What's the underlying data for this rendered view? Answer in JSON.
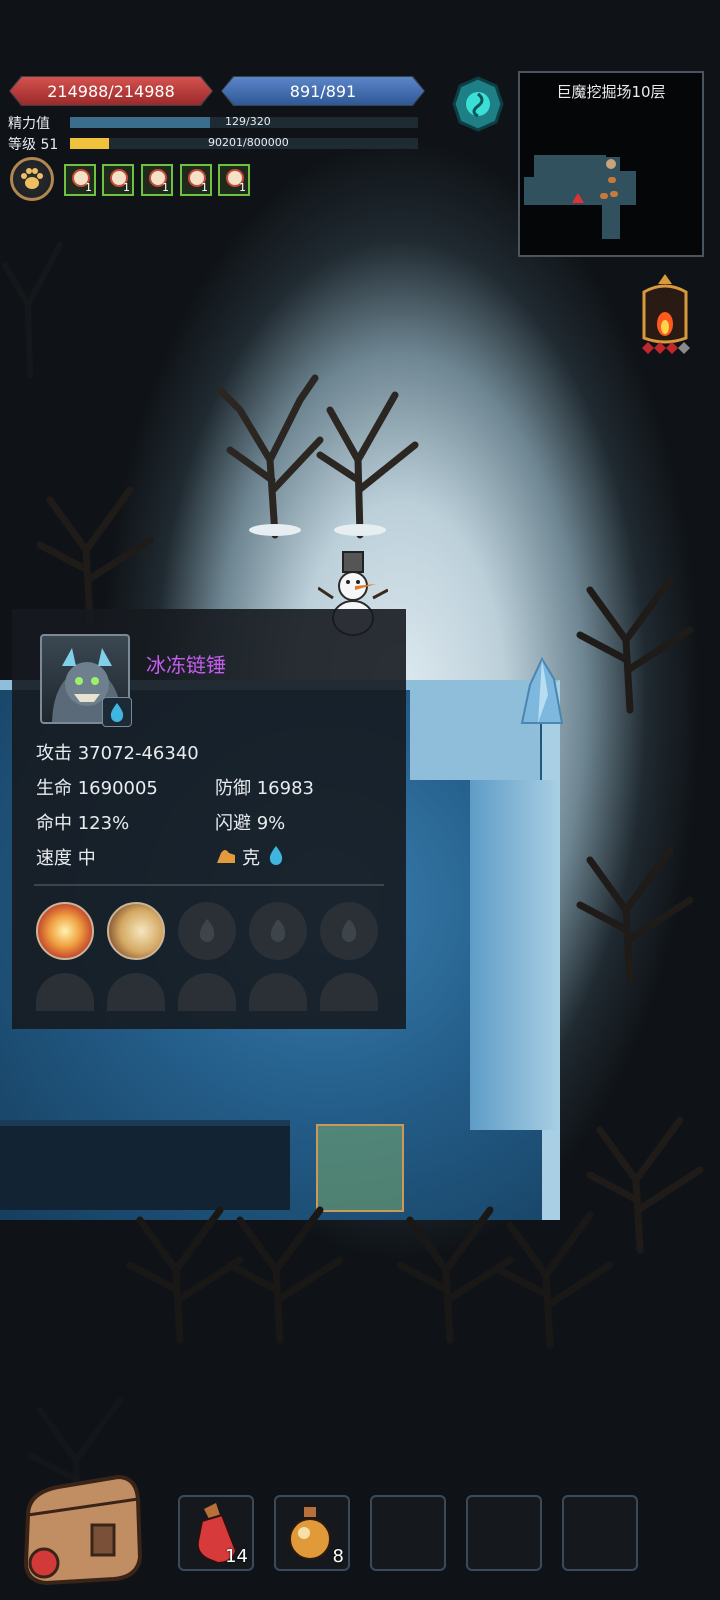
{
  "hud": {
    "hp": "214988/214988",
    "mp": "891/891",
    "stamina_label": "精力值",
    "stamina_value": "129/320",
    "stamina_fraction": 0.403,
    "level_label": "等级 51",
    "exp_value": "90201/800000",
    "exp_fraction": 0.113,
    "buffs": [
      {
        "icon": "star-buff-icon",
        "count": "1"
      },
      {
        "icon": "star-buff-icon",
        "count": "1"
      },
      {
        "icon": "star-buff-icon",
        "count": "1"
      },
      {
        "icon": "star-buff-icon",
        "count": "1"
      },
      {
        "icon": "star-buff-icon",
        "count": "1"
      }
    ],
    "colors": {
      "hp": "#c0403c",
      "mp": "#4672b4",
      "stamina": "#3a6e8c",
      "exp": "#f0c13a",
      "buff_border": "#6fc23f"
    }
  },
  "minimap": {
    "title": "巨魔挖掘场10层"
  },
  "monster_panel": {
    "name": "冰冻链锤",
    "name_color": "#c65cf0",
    "element_icon": "water-drop-icon",
    "attack": "攻击 37072-46340",
    "hp": "生命 1690005",
    "defense": "防御 16983",
    "accuracy": "命中 123%",
    "evasion": "闪避 9%",
    "speed": "速度 中",
    "counter": "克",
    "skills": [
      "burst-skill-icon",
      "claw-skill-icon",
      "empty",
      "empty",
      "empty",
      "empty",
      "empty",
      "empty",
      "empty",
      "empty"
    ]
  },
  "toolbar": {
    "items": [
      {
        "icon": "red-potion-icon",
        "count": "14"
      },
      {
        "icon": "orange-potion-icon",
        "count": "8"
      },
      {
        "icon": "",
        "count": ""
      },
      {
        "icon": "",
        "count": ""
      },
      {
        "icon": "",
        "count": ""
      }
    ]
  }
}
